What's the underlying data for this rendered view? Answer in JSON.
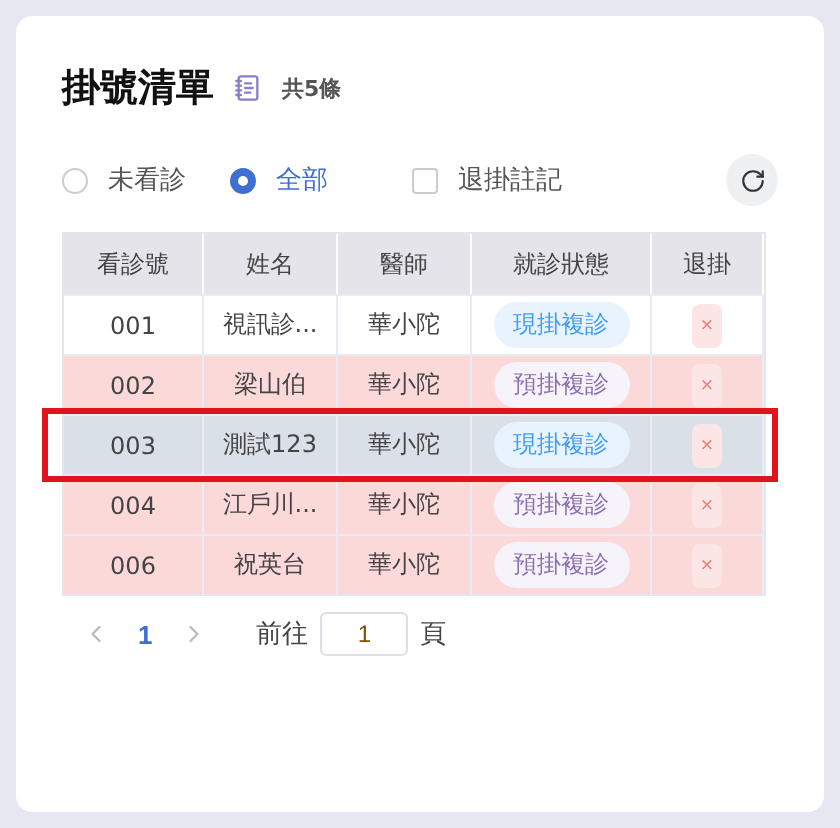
{
  "title": "掛號清單",
  "count": "共5條",
  "filters": [
    {
      "label": "未看診",
      "selected": false
    },
    {
      "label": "全部",
      "selected": true
    }
  ],
  "cancel_note": {
    "label": "退掛註記",
    "checked": false
  },
  "table": {
    "columns": [
      "看診號",
      "姓名",
      "醫師",
      "就診狀態",
      "退掛"
    ],
    "rows": [
      {
        "number": "001",
        "name": "視訊診...",
        "doctor": "華小陀",
        "status": "現掛複診",
        "kind": "current",
        "cancel": "×",
        "flagged": false,
        "selected": false
      },
      {
        "number": "002",
        "name": "梁山伯",
        "doctor": "華小陀",
        "status": "預掛複診",
        "kind": "booked",
        "cancel": "×",
        "flagged": true,
        "selected": false
      },
      {
        "number": "003",
        "name": "測試123",
        "doctor": "華小陀",
        "status": "現掛複診",
        "kind": "current",
        "cancel": "×",
        "flagged": false,
        "selected": true
      },
      {
        "number": "004",
        "name": "江戶川...",
        "doctor": "華小陀",
        "status": "預掛複診",
        "kind": "booked",
        "cancel": "×",
        "flagged": true,
        "selected": false
      },
      {
        "number": "006",
        "name": "祝英台",
        "doctor": "華小陀",
        "status": "預掛複診",
        "kind": "booked",
        "cancel": "×",
        "flagged": true,
        "selected": false
      }
    ]
  },
  "pagination": {
    "pages": [
      {
        "label": "1",
        "selected": true
      }
    ],
    "goto_label": "前往",
    "goto_value": "1",
    "page_suffix": "頁"
  }
}
